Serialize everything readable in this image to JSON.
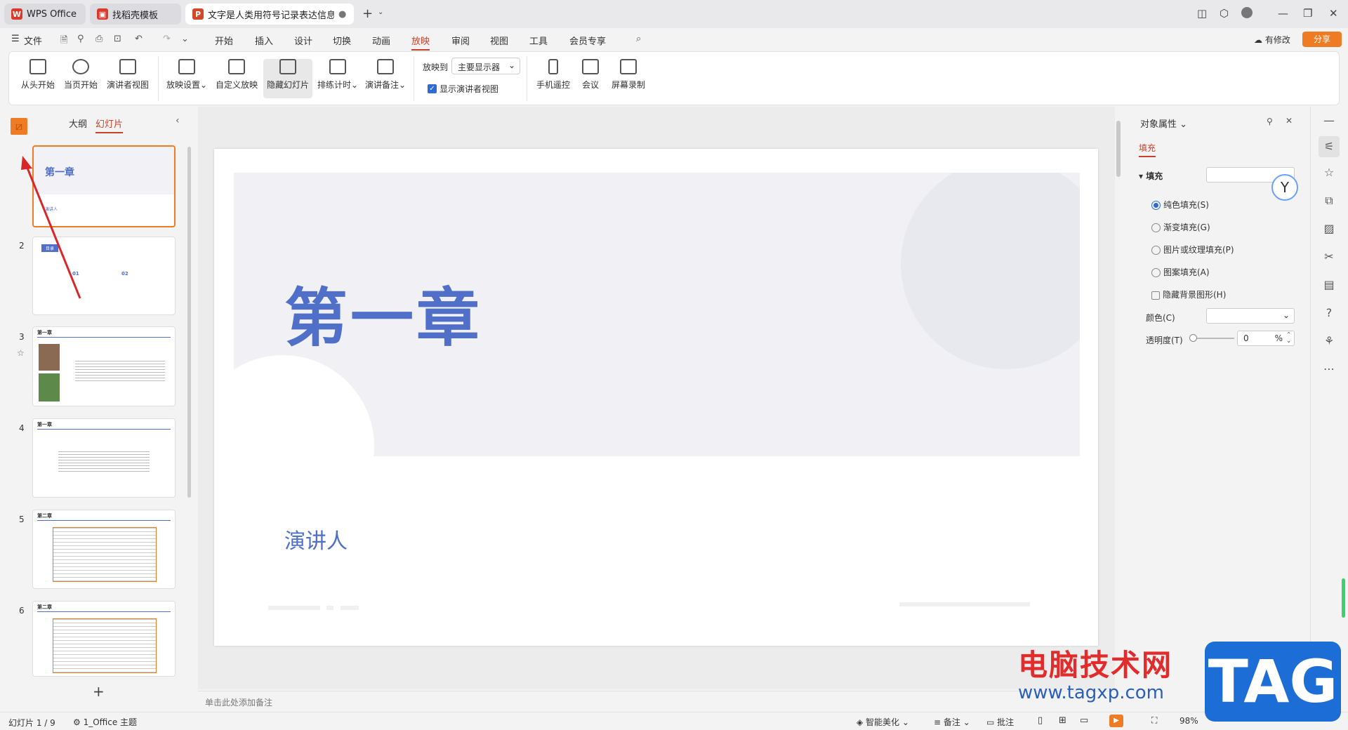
{
  "tabs": [
    {
      "label": "WPS Office"
    },
    {
      "label": "找稻壳模板"
    },
    {
      "label": "文字是人类用符号记录表达信息以"
    }
  ],
  "menu": {
    "file": "文件",
    "items": [
      "开始",
      "插入",
      "设计",
      "切换",
      "动画",
      "放映",
      "审阅",
      "视图",
      "工具",
      "会员专享"
    ],
    "active": "放映",
    "revision": "有修改",
    "share": "分享"
  },
  "ribbon": {
    "from_start": "从头开始",
    "from_current": "当页开始",
    "presenter_view": "演讲者视图",
    "show_settings": "放映设置",
    "custom_show": "自定义放映",
    "hide_slide": "隐藏幻灯片",
    "rehearse": "排练计时",
    "notes": "演讲备注",
    "play_to_label": "放映到",
    "play_to_value": "主要显示器",
    "show_presenter": "显示演讲者视图",
    "phone_remote": "手机遥控",
    "meeting": "会议",
    "screen_record": "屏幕录制"
  },
  "left_panel": {
    "tab_outline": "大纲",
    "tab_slides": "幻灯片",
    "slides": [
      {
        "num": "1",
        "title": "第一章",
        "sub": "演讲人"
      },
      {
        "num": "2",
        "title": "目录",
        "i1": "01",
        "i2": "02"
      },
      {
        "num": "3",
        "title": "第一章"
      },
      {
        "num": "4",
        "title": "第一章"
      },
      {
        "num": "5",
        "title": "第二章"
      },
      {
        "num": "6",
        "title": "第二章"
      }
    ],
    "add": "+"
  },
  "slide": {
    "title": "第一章",
    "presenter": "演讲人"
  },
  "notes_placeholder": "单击此处添加备注",
  "right_panel": {
    "title": "对象属性",
    "tab_fill": "填充",
    "section_fill": "填充",
    "solid": "纯色填充(S)",
    "gradient": "渐变填充(G)",
    "picture": "图片或纹理填充(P)",
    "pattern": "图案填充(A)",
    "hide_bg": "隐藏背景图形(H)",
    "color_label": "颜色(C)",
    "transparency_label": "透明度(T)",
    "transparency_value": "0",
    "percent": "%"
  },
  "status": {
    "slide_info": "幻灯片 1 / 9",
    "theme": "1_Office 主题",
    "beautify": "智能美化",
    "notes": "备注",
    "comments": "批注",
    "zoom": "98%"
  },
  "watermark": {
    "site": "电脑技术网",
    "url": "www.tagxp.com",
    "tag": "TAG"
  },
  "colors": {
    "accent": "#c7432c",
    "title_blue": "#4f6fc8",
    "orange": "#f07b25"
  }
}
